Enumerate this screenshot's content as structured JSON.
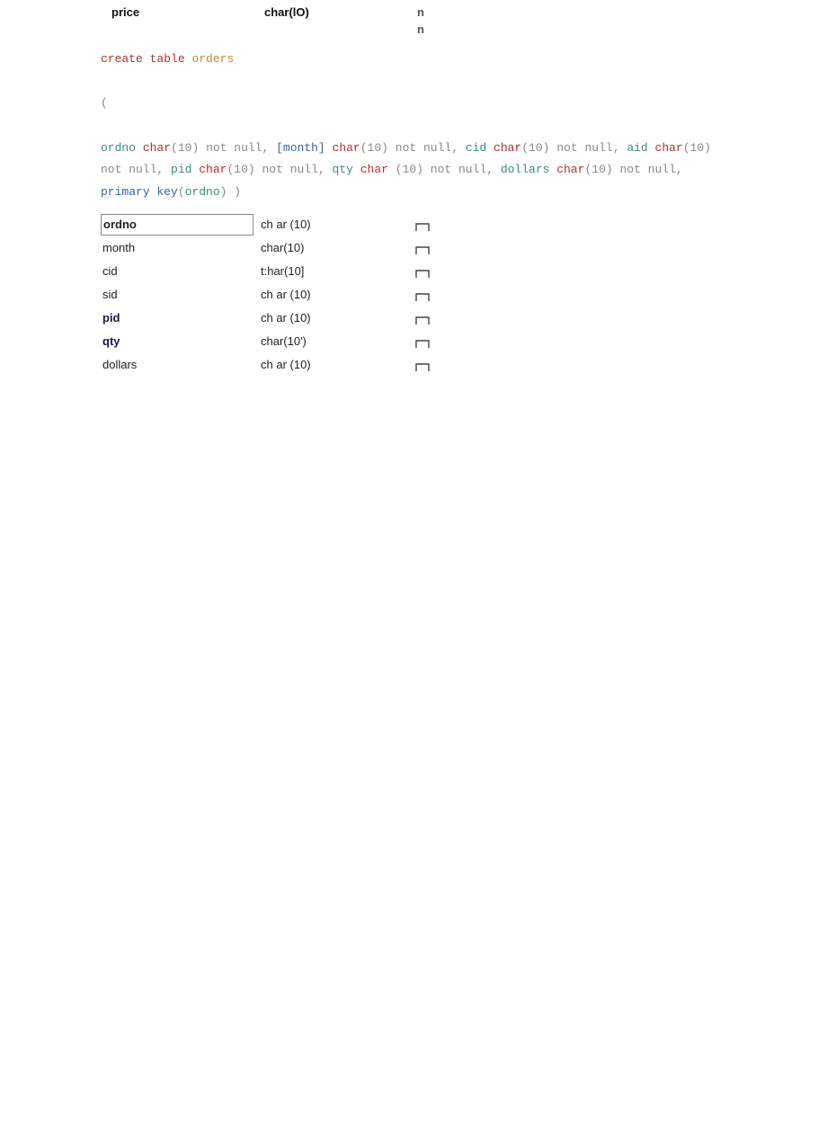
{
  "header": {
    "col1": "price",
    "col2": "char(lO)",
    "right1": "n",
    "right2": "n"
  },
  "sql": {
    "create": "create",
    "table_kw": "table",
    "orders": "orders",
    "lparen": "(",
    "ordno": "ordno",
    "char1": "char",
    "p1": "(10)",
    "nn": "not null,",
    "month": "[month]",
    "char2": "char",
    "p2": "(10)",
    "cid": "cid",
    "char3": "char",
    "p3": "(10)",
    "aid": "aid",
    "char4": "char",
    "p4": "(10)",
    "pid": "pid",
    "char5": "char",
    "p5": "(10)",
    "qty": "qty",
    "char6": "char",
    "p6": " (10)",
    "dollars": "dollars",
    "char7": "char",
    "p7": "(10)",
    "pk": "primary key",
    "pk_l": "(",
    "pk_col": "ordno",
    "pk_r": ")",
    "rparen": " )"
  },
  "table": {
    "rows": [
      {
        "name": "ordno",
        "type": "ch ar (10)",
        "bold": true,
        "boxed": true,
        "dark": false
      },
      {
        "name": "month",
        "type": "char(10)",
        "bold": false,
        "boxed": false,
        "dark": false
      },
      {
        "name": "cid",
        "type": "t:har(10]",
        "bold": false,
        "boxed": false,
        "dark": false
      },
      {
        "name": "sid",
        "type": "ch ar (10)",
        "bold": false,
        "boxed": false,
        "dark": false
      },
      {
        "name": "pid",
        "type": "ch ar (10)",
        "bold": true,
        "boxed": false,
        "dark": true
      },
      {
        "name": "qty",
        "type": "char(10')",
        "bold": true,
        "boxed": false,
        "dark": true
      },
      {
        "name": "dollars",
        "type": "ch ar (10)",
        "bold": false,
        "boxed": false,
        "dark": false
      }
    ]
  }
}
